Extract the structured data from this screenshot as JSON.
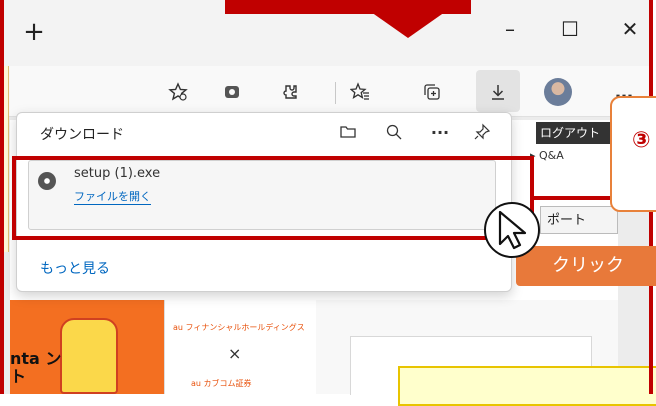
{
  "titlebar": {
    "new_tab_icon": "plus-icon",
    "controls": [
      "minimize-icon",
      "maximize-icon",
      "close-icon"
    ]
  },
  "toolbar": {
    "more_label": "…"
  },
  "background_page": {
    "logout_label": "ログアウト",
    "qa_link": "▸ Q&A",
    "support_label": "ポート",
    "ad_title": "au フィナンシャルホールディングス",
    "ad_times": "×",
    "ad_sub": "au カブコム証券",
    "banner_text": "nta ント"
  },
  "download_panel": {
    "title": "ダウンロード",
    "items": [
      {
        "file_name": "setup (1).exe",
        "action_label": "ファイルを開く"
      }
    ],
    "more_link": "もっと見る"
  },
  "callouts": {
    "step_number": "③",
    "click_label": "クリック"
  },
  "colors": {
    "highlight_red": "#c00000",
    "callout_orange": "#e8793a",
    "link_blue": "#0067c0"
  }
}
